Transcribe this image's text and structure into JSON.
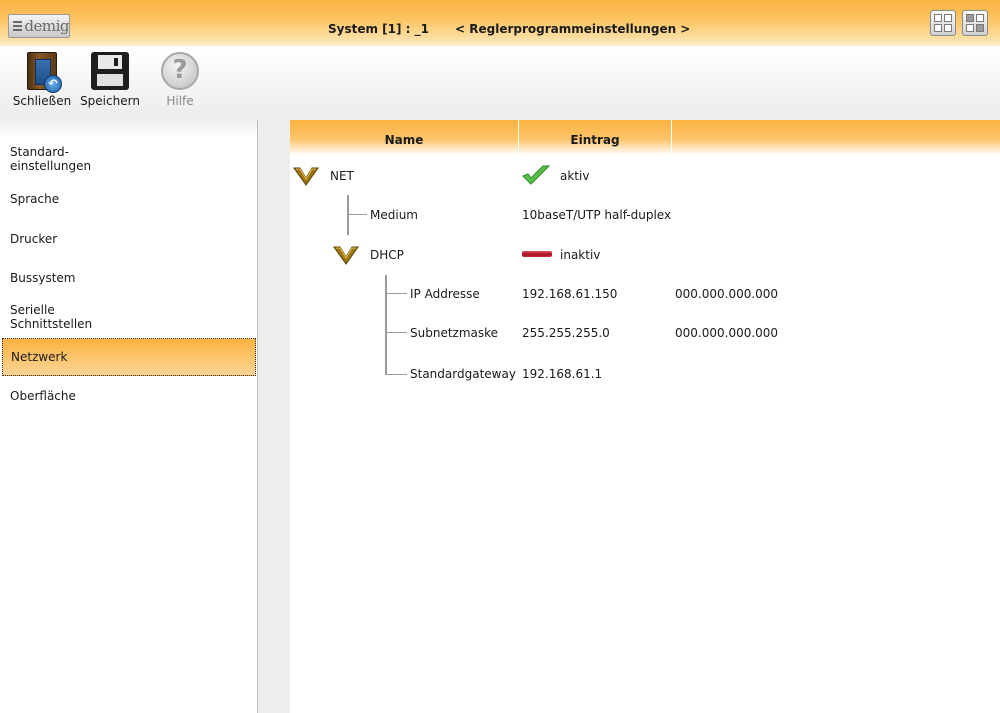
{
  "titlebar": {
    "logo_text": "demig",
    "system_label": "System [1] : _1",
    "program_label": "< Reglerprogrammeinstellungen >",
    "window_icons": [
      "tile-windows-icon",
      "cascade-windows-icon"
    ]
  },
  "toolbar": {
    "close_label": "Schließen",
    "save_label": "Speichern",
    "help_label": "Hilfe"
  },
  "sidebar": {
    "items": [
      {
        "label": "Standard-\neinstellungen"
      },
      {
        "label": "Sprache"
      },
      {
        "label": "Drucker"
      },
      {
        "label": "Bussystem"
      },
      {
        "label": "Serielle\nSchnittstellen"
      },
      {
        "label": "Netzwerk",
        "active": true
      },
      {
        "label": "Oberfläche"
      }
    ]
  },
  "grid": {
    "columns": [
      "Name",
      "Eintrag",
      ""
    ],
    "rows": [
      {
        "name": "NET",
        "entry": "aktiv",
        "extra": "",
        "icon": "check-icon"
      },
      {
        "name": "Medium",
        "entry": "10baseT/UTP half-duplex",
        "extra": ""
      },
      {
        "name": "DHCP",
        "entry": "inaktiv",
        "extra": "",
        "icon": "inactive-dash-icon"
      },
      {
        "name": "IP Addresse",
        "entry": "192.168.61.150",
        "extra": "000.000.000.000"
      },
      {
        "name": "Subnetzmaske",
        "entry": "255.255.255.0",
        "extra": "000.000.000.000"
      },
      {
        "name": "Standardgateway",
        "entry": "192.168.61.1",
        "extra": ""
      }
    ]
  },
  "colors": {
    "accent_orange": "#fbb240",
    "check_green": "#3aa838",
    "inactive_red": "#b01828"
  }
}
